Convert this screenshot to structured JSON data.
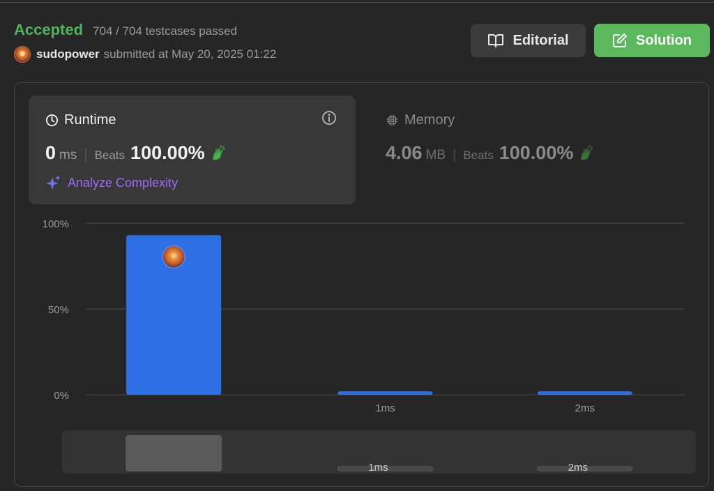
{
  "header": {
    "status": "Accepted",
    "testcases": "704 / 704 testcases passed",
    "username": "sudopower",
    "submitted_text": "submitted at May 20, 2025 01:22",
    "editorial_label": "Editorial",
    "solution_label": "Solution"
  },
  "runtime": {
    "title": "Runtime",
    "value": "0",
    "unit": "ms",
    "beats_label": "Beats",
    "beats_value": "100.00%",
    "analyze_label": "Analyze Complexity"
  },
  "memory": {
    "title": "Memory",
    "value": "4.06",
    "unit": "MB",
    "beats_label": "Beats",
    "beats_value": "100.00%"
  },
  "colors": {
    "accepted": "#4fb35c",
    "bar": "#2f6fe6",
    "solution_button": "#5cb85c",
    "analyze": "#9b6cf5"
  },
  "chart_data": {
    "type": "bar",
    "categories": [
      "",
      "1ms",
      "2ms"
    ],
    "values": [
      93,
      2,
      2
    ],
    "ylim": [
      0,
      100
    ],
    "yticks": [
      0,
      50,
      100
    ],
    "ytick_labels": [
      "0%",
      "50%",
      "100%"
    ],
    "highlight_index": 0,
    "grid": true
  },
  "mini_chart": {
    "categories": [
      "",
      "1ms",
      "2ms"
    ],
    "values": [
      93,
      2,
      2
    ]
  }
}
